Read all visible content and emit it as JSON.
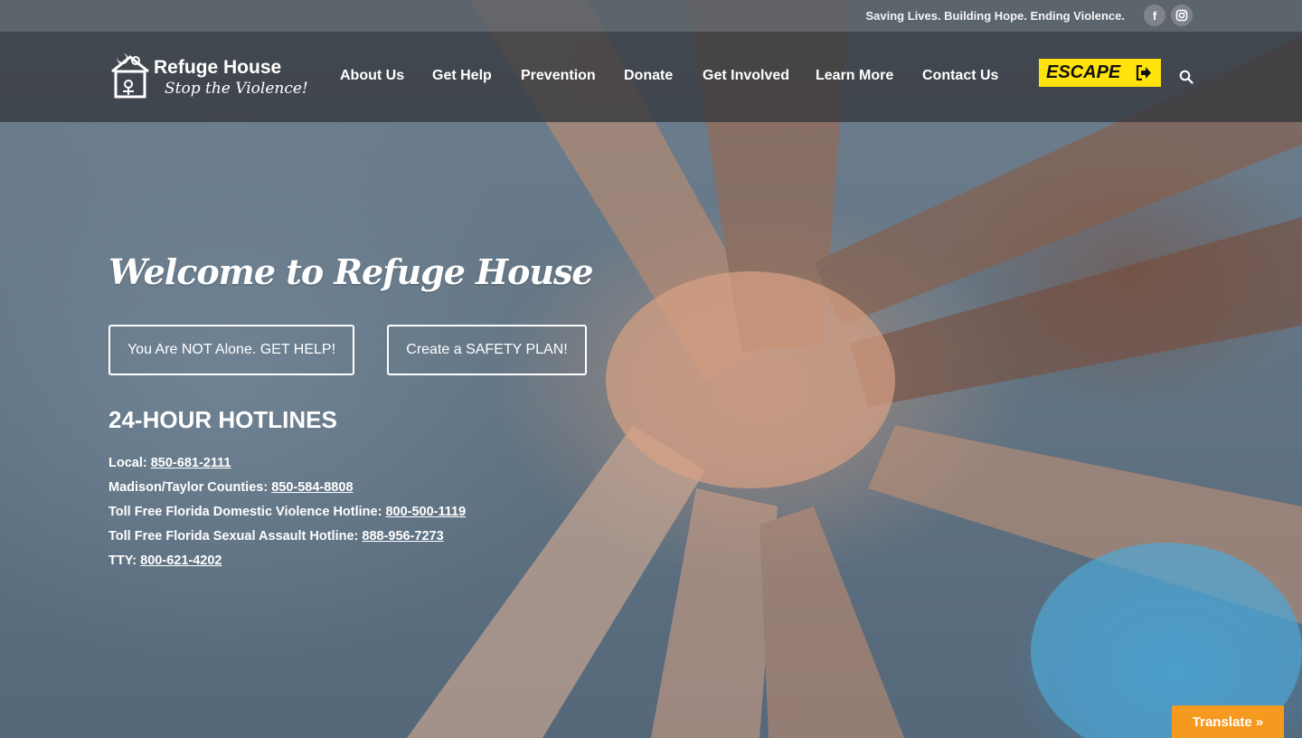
{
  "topbar": {
    "tagline": "Saving Lives. Building Hope. Ending Violence.",
    "social": [
      {
        "icon": "facebook-icon",
        "glyph": "f"
      },
      {
        "icon": "instagram-icon"
      }
    ]
  },
  "header": {
    "logo": {
      "name": "Refuge House",
      "subtitle": "Stop the Violence!",
      "icon": "house-logo-icon"
    },
    "nav": [
      {
        "label": "About Us"
      },
      {
        "label": "Get Help"
      },
      {
        "label": "Prevention"
      },
      {
        "label": "Donate"
      },
      {
        "label": "Get Involved"
      },
      {
        "label": "Learn More"
      },
      {
        "label": "Contact Us"
      }
    ],
    "escape_label": "ESCAPE",
    "escape_color": "#ffe30a",
    "search_icon": "search-icon"
  },
  "hero": {
    "welcome": "Welcome to Refuge House",
    "buttons": {
      "help": "You Are NOT Alone. GET HELP!",
      "plan": "Create a SAFETY PLAN!"
    },
    "hotlines_title": "24-HOUR HOTLINES",
    "hotlines": [
      {
        "label": "Local:",
        "number": "850-681-2111"
      },
      {
        "label": "Madison/Taylor Counties:",
        "number": "850-584-8808"
      },
      {
        "label": "Toll Free Florida Domestic Violence Hotline:",
        "number": "800-500-1119"
      },
      {
        "label": "Toll Free Florida Sexual Assault Hotline:",
        "number": "888-956-7273 "
      },
      {
        "label": "TTY:",
        "number": "800-621-4202"
      }
    ]
  },
  "translate": {
    "label": "Translate »",
    "color": "#f59a1f"
  }
}
